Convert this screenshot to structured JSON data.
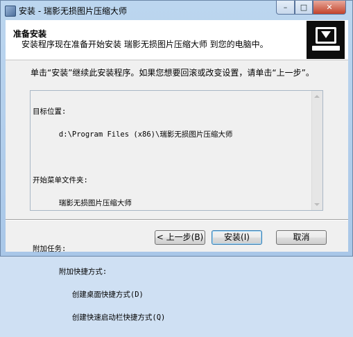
{
  "window": {
    "title": "安装 - 瑞影无损图片压缩大师",
    "minimize_glyph": "–",
    "maximize_glyph": "□",
    "close_glyph": "✕"
  },
  "header": {
    "title": "准备安装",
    "subtitle": "安装程序现在准备开始安装 瑞影无损图片压缩大师 到您的电脑中。"
  },
  "body": {
    "instruction": "单击“安装”继续此安装程序。如果您想要回滚或改变设置，请单击“上一步”。"
  },
  "memo": {
    "lines": [
      "目标位置:",
      "      d:\\Program Files (x86)\\瑞影无损图片压缩大师",
      "",
      "开始菜单文件夹:",
      "      瑞影无损图片压缩大师",
      "",
      "附加任务:",
      "      附加快捷方式:",
      "         创建桌面快捷方式(D)",
      "         创建快速启动栏快捷方式(Q)"
    ]
  },
  "buttons": {
    "back": "< 上一步(B)",
    "install": "安装(I)",
    "cancel": "取消"
  }
}
